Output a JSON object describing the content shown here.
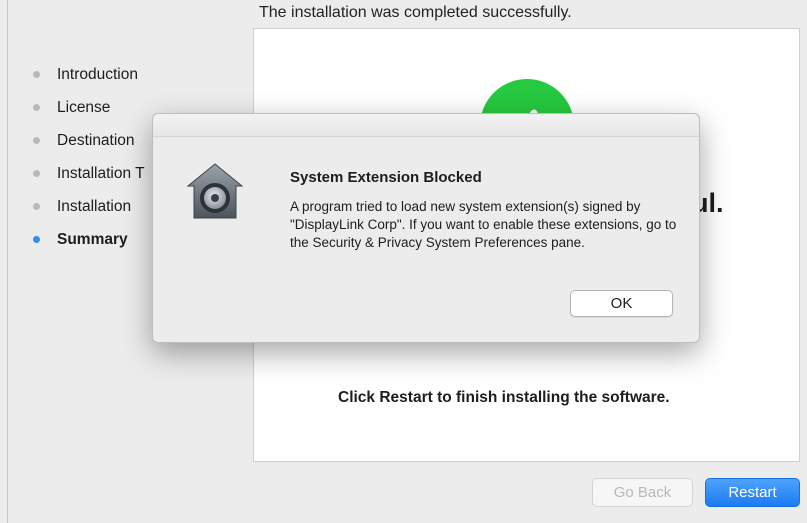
{
  "installer": {
    "heading": "The installation was completed successfully.",
    "steps": [
      {
        "label": "Introduction",
        "active": false
      },
      {
        "label": "License",
        "active": false
      },
      {
        "label": "Destination",
        "active": false
      },
      {
        "label": "Installation T",
        "active": false
      },
      {
        "label": "Installation",
        "active": false
      },
      {
        "label": "Summary",
        "active": true
      }
    ],
    "content_title_fragment": "ul.",
    "footer_text": "Click Restart to finish installing the software.",
    "go_back_label": "Go Back",
    "restart_label": "Restart"
  },
  "alert": {
    "title": "System Extension Blocked",
    "message": "A program tried to load new system extension(s) signed by \"DisplayLink Corp\".  If you want to enable these extensions, go to the Security & Privacy System Preferences pane.",
    "ok_label": "OK",
    "icon": "security-gatekeeper-icon"
  },
  "colors": {
    "accent_blue": "#2f8cf5",
    "success_green": "#26c93f"
  }
}
